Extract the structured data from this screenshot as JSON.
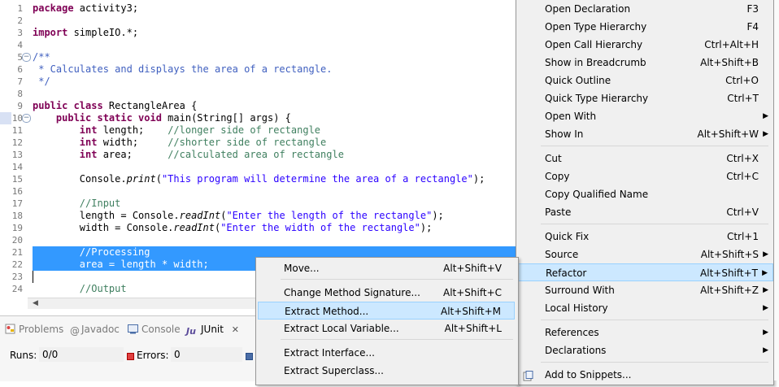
{
  "editor": {
    "lines": [
      {
        "n": "1",
        "segs": [
          {
            "c": "kw",
            "t": "package"
          },
          {
            "c": "",
            "t": " activity3;"
          }
        ]
      },
      {
        "n": "2",
        "segs": []
      },
      {
        "n": "3",
        "segs": [
          {
            "c": "kw",
            "t": "import"
          },
          {
            "c": "",
            "t": " simpleIO.*;"
          }
        ]
      },
      {
        "n": "4",
        "segs": []
      },
      {
        "n": "5",
        "fold": "−",
        "segs": [
          {
            "c": "jd",
            "t": "/**"
          }
        ]
      },
      {
        "n": "6",
        "segs": [
          {
            "c": "jd",
            "t": " * Calculates and displays the area of a rectangle."
          }
        ]
      },
      {
        "n": "7",
        "segs": [
          {
            "c": "jd",
            "t": " */"
          }
        ]
      },
      {
        "n": "8",
        "segs": []
      },
      {
        "n": "9",
        "segs": [
          {
            "c": "kw",
            "t": "public class"
          },
          {
            "c": "",
            "t": " RectangleArea {"
          }
        ]
      },
      {
        "n": "10",
        "fold": "−",
        "segs": [
          {
            "c": "",
            "t": "    "
          },
          {
            "c": "kw",
            "t": "public static void"
          },
          {
            "c": "",
            "t": " main(String[] args) {"
          }
        ]
      },
      {
        "n": "11",
        "segs": [
          {
            "c": "",
            "t": "        "
          },
          {
            "c": "kw",
            "t": "int"
          },
          {
            "c": "",
            "t": " length;    "
          },
          {
            "c": "cm",
            "t": "//longer side of rectangle"
          }
        ]
      },
      {
        "n": "12",
        "segs": [
          {
            "c": "",
            "t": "        "
          },
          {
            "c": "kw",
            "t": "int"
          },
          {
            "c": "",
            "t": " width;     "
          },
          {
            "c": "cm",
            "t": "//shorter side of rectangle"
          }
        ]
      },
      {
        "n": "13",
        "segs": [
          {
            "c": "",
            "t": "        "
          },
          {
            "c": "kw",
            "t": "int"
          },
          {
            "c": "",
            "t": " area;      "
          },
          {
            "c": "cm",
            "t": "//calculated area of rectangle"
          }
        ]
      },
      {
        "n": "14",
        "segs": []
      },
      {
        "n": "15",
        "segs": [
          {
            "c": "",
            "t": "        Console."
          },
          {
            "c": "it",
            "t": "print"
          },
          {
            "c": "",
            "t": "("
          },
          {
            "c": "st",
            "t": "\"This program will determine the area of a rectangle\""
          },
          {
            "c": "",
            "t": ");"
          }
        ]
      },
      {
        "n": "16",
        "segs": []
      },
      {
        "n": "17",
        "segs": [
          {
            "c": "",
            "t": "        "
          },
          {
            "c": "cm",
            "t": "//Input"
          }
        ]
      },
      {
        "n": "18",
        "segs": [
          {
            "c": "",
            "t": "        length = Console."
          },
          {
            "c": "it",
            "t": "readInt"
          },
          {
            "c": "",
            "t": "("
          },
          {
            "c": "st",
            "t": "\"Enter the length of the rectangle\""
          },
          {
            "c": "",
            "t": ");"
          }
        ]
      },
      {
        "n": "19",
        "segs": [
          {
            "c": "",
            "t": "        width = Console."
          },
          {
            "c": "it",
            "t": "readInt"
          },
          {
            "c": "",
            "t": "("
          },
          {
            "c": "st",
            "t": "\"Enter the width of the rectangle\""
          },
          {
            "c": "",
            "t": ");"
          }
        ]
      },
      {
        "n": "20",
        "segs": []
      },
      {
        "n": "21",
        "sel": true,
        "segs": [
          {
            "c": "",
            "t": "        //Processing"
          }
        ]
      },
      {
        "n": "22",
        "sel": true,
        "segs": [
          {
            "c": "",
            "t": "        area = length * width;"
          }
        ]
      },
      {
        "n": "23",
        "segs": []
      },
      {
        "n": "24",
        "segs": [
          {
            "c": "",
            "t": "        "
          },
          {
            "c": "cm",
            "t": "//Output"
          }
        ]
      }
    ]
  },
  "bottom_panel": {
    "tabs": [
      {
        "label": "Problems",
        "active": false
      },
      {
        "label": "Javadoc",
        "active": false
      },
      {
        "label": "Console",
        "active": false
      },
      {
        "label": "JUnit",
        "active": true
      }
    ],
    "runs_label": "Runs:",
    "runs_value": "0/0",
    "errors_label": "Errors:",
    "errors_value": "0"
  },
  "context_menu": {
    "items": [
      {
        "label": "Open Declaration",
        "accel": "F3"
      },
      {
        "label": "Open Type Hierarchy",
        "accel": "F4"
      },
      {
        "label": "Open Call Hierarchy",
        "accel": "Ctrl+Alt+H"
      },
      {
        "label": "Show in Breadcrumb",
        "accel": "Alt+Shift+B"
      },
      {
        "label": "Quick Outline",
        "accel": "Ctrl+O"
      },
      {
        "label": "Quick Type Hierarchy",
        "accel": "Ctrl+T"
      },
      {
        "label": "Open With",
        "accel": "",
        "sub": true
      },
      {
        "label": "Show In",
        "accel": "Alt+Shift+W",
        "sub": true
      },
      {
        "label": "Cut",
        "accel": "Ctrl+X"
      },
      {
        "label": "Copy",
        "accel": "Ctrl+C"
      },
      {
        "label": "Copy Qualified Name",
        "accel": ""
      },
      {
        "label": "Paste",
        "accel": "Ctrl+V"
      },
      {
        "label": "Quick Fix",
        "accel": "Ctrl+1"
      },
      {
        "label": "Source",
        "accel": "Alt+Shift+S",
        "sub": true
      },
      {
        "label": "Refactor",
        "accel": "Alt+Shift+T",
        "sub": true
      },
      {
        "label": "Surround With",
        "accel": "Alt+Shift+Z",
        "sub": true
      },
      {
        "label": "Local History",
        "accel": "",
        "sub": true
      },
      {
        "label": "References",
        "accel": "",
        "sub": true
      },
      {
        "label": "Declarations",
        "accel": "",
        "sub": true
      },
      {
        "label": "Add to Snippets...",
        "accel": ""
      }
    ]
  },
  "refactor_submenu": {
    "items": [
      {
        "label": "Move...",
        "accel": "Alt+Shift+V"
      },
      {
        "label": "Change Method Signature...",
        "accel": "Alt+Shift+C"
      },
      {
        "label": "Extract Method...",
        "accel": "Alt+Shift+M"
      },
      {
        "label": "Extract Local Variable...",
        "accel": "Alt+Shift+L"
      },
      {
        "label": "Extract Interface...",
        "accel": ""
      },
      {
        "label": "Extract Superclass...",
        "accel": ""
      }
    ]
  },
  "colors": {
    "selection": "#3399ff",
    "menu_highlight": "#cce8ff",
    "keyword": "#7f0055",
    "comment": "#3f7f5f",
    "javadoc": "#3f5fbf",
    "string": "#2a00ff"
  }
}
